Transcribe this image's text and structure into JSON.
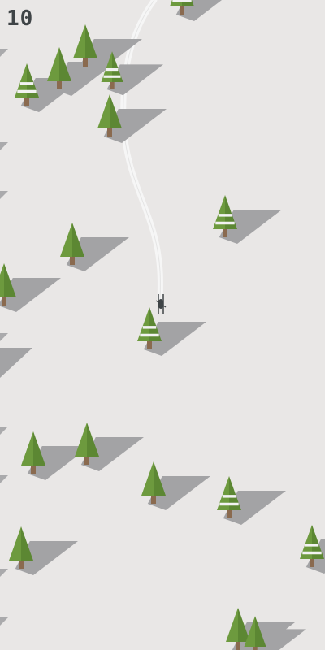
{
  "hud": {
    "score": "10"
  },
  "colors": {
    "snow": "#e9e7e6",
    "trail": "#f6f6f6",
    "shadow": "#a3a3a5",
    "tree_green": "#6d9a3e",
    "tree_green_dark": "#5c8733",
    "trunk": "#8a6a4f",
    "snow_band": "#f2f2f2",
    "skier": "#3f4447"
  },
  "scene": {
    "player": {
      "icon": "skier-icon"
    },
    "trees": [
      {
        "variant": "snowy"
      },
      {
        "variant": "plain"
      },
      {
        "variant": "snowy"
      },
      {
        "variant": "plain"
      },
      {
        "variant": "snowy"
      },
      {
        "variant": "plain"
      },
      {
        "variant": "snowy"
      },
      {
        "variant": "plain"
      },
      {
        "variant": "plain"
      },
      {
        "variant": "snowy"
      },
      {
        "variant": "plain"
      },
      {
        "variant": "plain"
      },
      {
        "variant": "plain"
      },
      {
        "variant": "snowy"
      },
      {
        "variant": "plain"
      },
      {
        "variant": "snowy"
      },
      {
        "variant": "plain"
      },
      {
        "variant": "plain"
      },
      {
        "variant": "plain"
      },
      {
        "variant": "snowy"
      }
    ]
  }
}
